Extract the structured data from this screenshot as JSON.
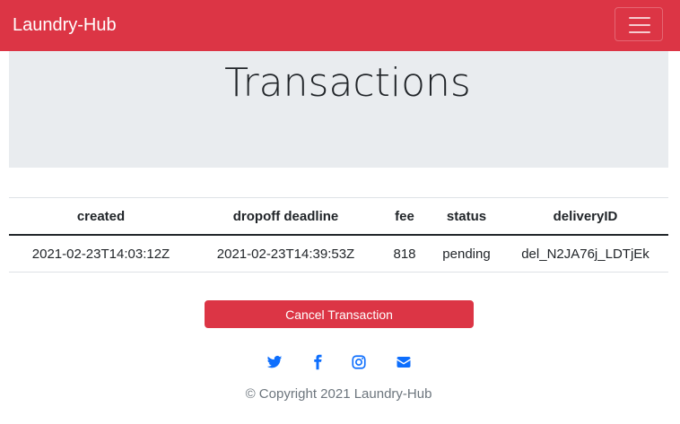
{
  "navbar": {
    "brand": "Laundry-Hub",
    "toggler_icon": "hamburger-menu-icon",
    "background": "#dc3545"
  },
  "jumbotron": {
    "title": "Transactions"
  },
  "table": {
    "headers": [
      "created",
      "dropoff deadline",
      "fee",
      "status",
      "deliveryID"
    ],
    "rows": [
      [
        "2021-02-23T14:03:12Z",
        "2021-02-23T14:39:53Z",
        "818",
        "pending",
        "del_N2JA76j_LDTjEk"
      ]
    ]
  },
  "actions": {
    "cancel_label": "Cancel Transaction"
  },
  "footer": {
    "social": [
      {
        "name": "twitter",
        "icon": "twitter-icon"
      },
      {
        "name": "facebook",
        "icon": "facebook-icon"
      },
      {
        "name": "instagram",
        "icon": "instagram-icon"
      },
      {
        "name": "email",
        "icon": "envelope-icon"
      }
    ],
    "copyright": "© Copyright 2021 Laundry-Hub",
    "icon_color": "#0d6efd"
  }
}
